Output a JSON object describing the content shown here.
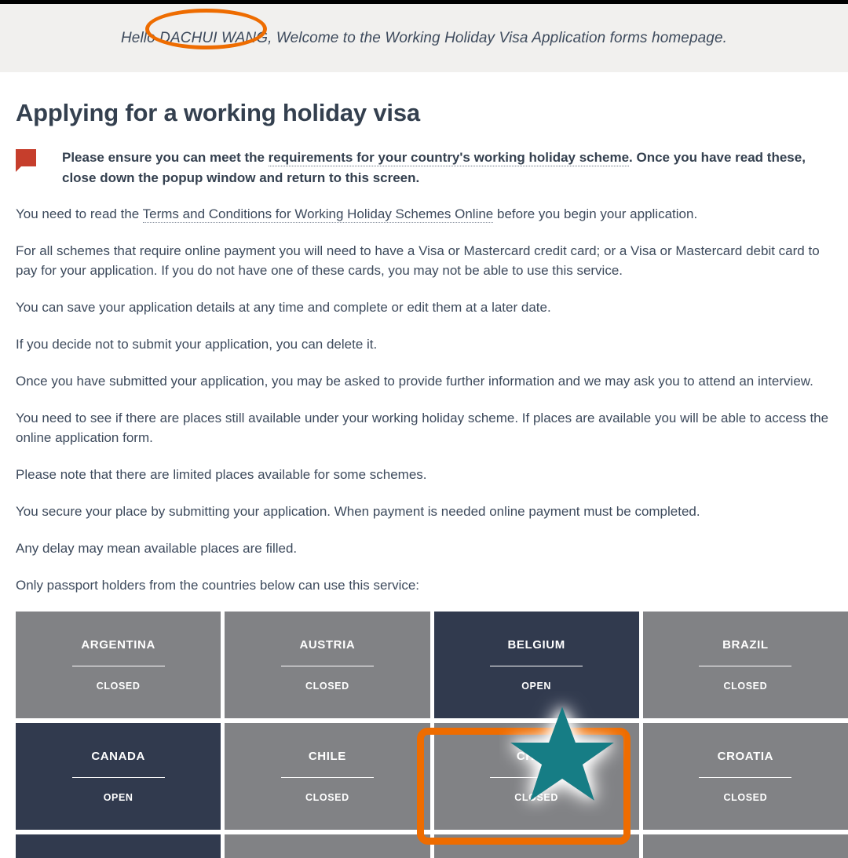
{
  "greeting": {
    "prefix": "Hello ",
    "user_name": "DACHUI WANG,",
    "suffix": " Welcome to the Working Holiday Visa Application forms homepage.",
    "full": "Hello DACHUI WANG, Welcome to the Working Holiday Visa Application forms homepage."
  },
  "page": {
    "title": "Applying for a working holiday visa"
  },
  "notice": {
    "icon": "note-callout-icon",
    "lead": "Please ensure you can meet the ",
    "link": "requirements for your country's working holiday scheme",
    "tail": ". Once you have read these, close down the popup window and return to this screen."
  },
  "paragraphs": [
    {
      "id": "terms",
      "before": "You need to read the ",
      "link": "Terms and Conditions for Working Holiday Schemes Online",
      "after": " before you begin your application."
    },
    {
      "id": "payment",
      "text": "For all schemes that require online payment you will need to have a Visa or Mastercard credit card; or a Visa or Mastercard debit card to pay for your application. If you do not have one of these cards, you may not be able to use this service."
    },
    {
      "id": "save",
      "text": "You can save your application details at any time and complete or edit them at a later date."
    },
    {
      "id": "delete",
      "text": "If you decide not to submit your application, you can delete it."
    },
    {
      "id": "interview",
      "text": "Once you have submitted your application, you may be asked to provide further information and we may ask you to attend an interview."
    },
    {
      "id": "places",
      "text": "You need to see if there are places still available under your working holiday scheme. If places are available you will be able to access the online application form."
    },
    {
      "id": "limited",
      "text": "Please note that there are limited places available for some schemes."
    },
    {
      "id": "secure",
      "text": "You secure your place by submitting your application. When payment is needed online payment must be completed."
    },
    {
      "id": "delay",
      "text": "Any delay may mean available places are filled."
    },
    {
      "id": "only-passport",
      "text": "Only passport holders from the countries below can use this service:"
    }
  ],
  "country_grid": {
    "status_labels": {
      "open": "OPEN",
      "closed": "CLOSED"
    },
    "tiles": [
      {
        "name": "ARGENTINA",
        "status": "CLOSED",
        "open": false
      },
      {
        "name": "AUSTRIA",
        "status": "CLOSED",
        "open": false
      },
      {
        "name": "BELGIUM",
        "status": "OPEN",
        "open": true
      },
      {
        "name": "BRAZIL",
        "status": "CLOSED",
        "open": false
      },
      {
        "name": "CANADA",
        "status": "OPEN",
        "open": true
      },
      {
        "name": "CHILE",
        "status": "CLOSED",
        "open": false
      },
      {
        "name": "CHINA",
        "status": "CLOSED",
        "open": false
      },
      {
        "name": "CROATIA",
        "status": "CLOSED",
        "open": false
      }
    ],
    "partial_row": [
      {
        "name": "",
        "status": "",
        "open": true
      },
      {
        "name": "",
        "status": "",
        "open": false
      },
      {
        "name": "",
        "status": "",
        "open": false
      },
      {
        "name": "",
        "status": "",
        "open": false
      }
    ]
  },
  "annotations": {
    "color": "#ee6c00",
    "star_color": "#127d85",
    "highlighted_name": "DACHUI WANG,",
    "highlighted_tile": "CHINA"
  },
  "colors": {
    "navy": "#313a4e",
    "gray_tile": "#818285",
    "band": "#f1f0ee",
    "text": "#3d4a5c",
    "notice_icon": "#c63e2c"
  }
}
